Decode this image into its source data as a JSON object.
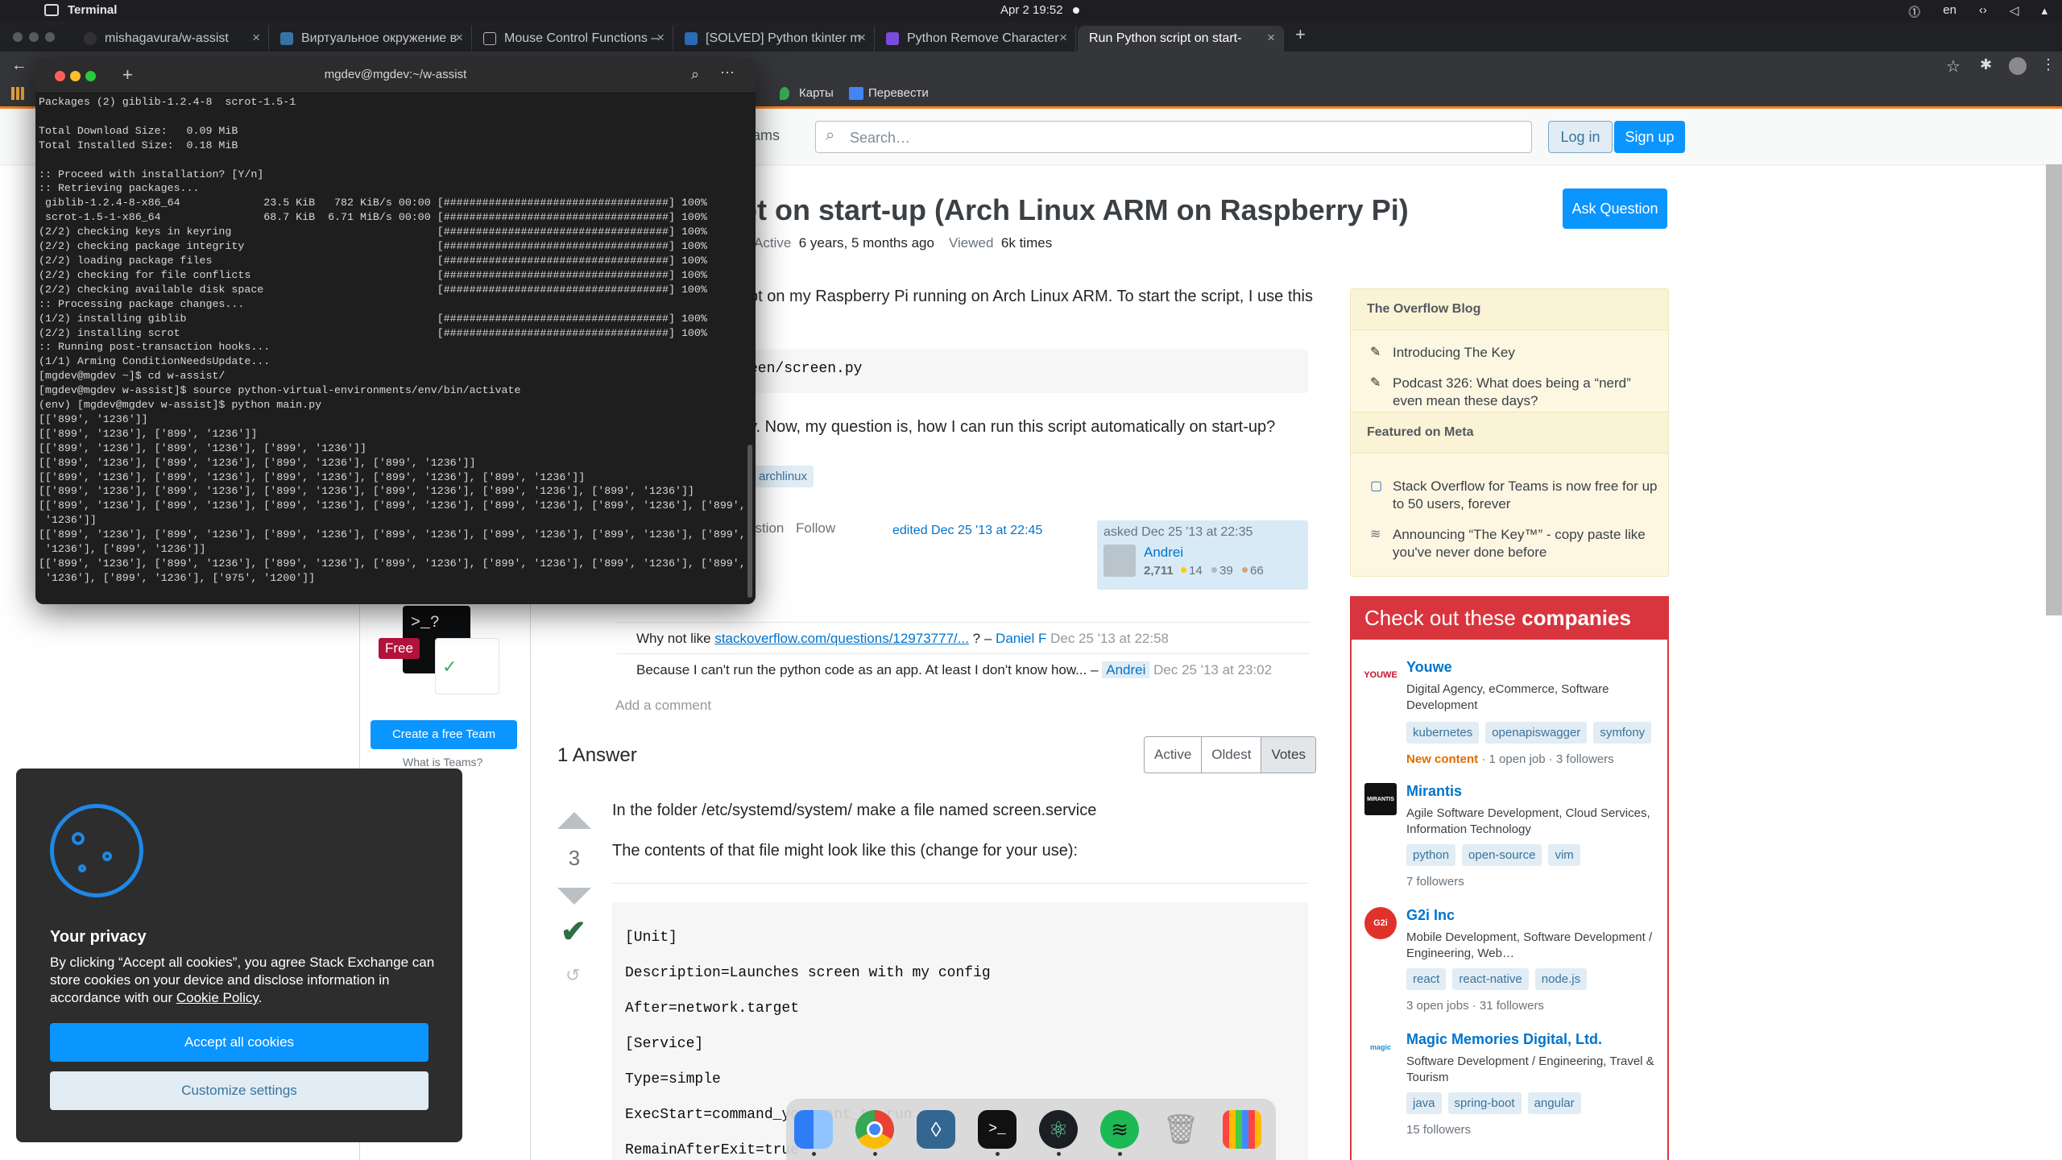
{
  "menubar": {
    "app_name": "Terminal",
    "clock": "Apr 2  19:52",
    "lang": "en"
  },
  "browser": {
    "tabs": [
      {
        "label": "mishagavura/w-assist"
      },
      {
        "label": "Виртуальное окружение в"
      },
      {
        "label": "Mouse Control Functions – "
      },
      {
        "label": "[SOLVED] Python tkinter m"
      },
      {
        "label": "Python Remove Character"
      },
      {
        "label": "Run Python script on start-"
      }
    ],
    "bookmarks": [
      {
        "label": "Карты"
      },
      {
        "label": "Перевести"
      }
    ]
  },
  "terminal": {
    "title": "mgdev@mgdev:~/w-assist",
    "lines": [
      "Packages (2) giblib-1.2.4-8  scrot-1.5-1",
      "",
      "Total Download Size:   0.09 MiB",
      "Total Installed Size:  0.18 MiB",
      "",
      ":: Proceed with installation? [Y/n]",
      ":: Retrieving packages...",
      " giblib-1.2.4-8-x86_64             23.5 KiB   782 KiB/s 00:00 [###################################] 100%",
      " scrot-1.5-1-x86_64                68.7 KiB  6.71 MiB/s 00:00 [###################################] 100%",
      "(2/2) checking keys in keyring                                [###################################] 100%",
      "(2/2) checking package integrity                              [###################################] 100%",
      "(2/2) loading package files                                   [###################################] 100%",
      "(2/2) checking for file conflicts                             [###################################] 100%",
      "(2/2) checking available disk space                           [###################################] 100%",
      ":: Processing package changes...",
      "(1/2) installing giblib                                       [###################################] 100%",
      "(2/2) installing scrot                                        [###################################] 100%",
      ":: Running post-transaction hooks...",
      "(1/1) Arming ConditionNeedsUpdate...",
      "[mgdev@mgdev ~]$ cd w-assist/",
      "[mgdev@mgdev w-assist]$ source python-virtual-environments/env/bin/activate",
      "(env) [mgdev@mgdev w-assist]$ python main.py",
      "[['899', '1236']]",
      "[['899', '1236'], ['899', '1236']]",
      "[['899', '1236'], ['899', '1236'], ['899', '1236']]",
      "[['899', '1236'], ['899', '1236'], ['899', '1236'], ['899', '1236']]",
      "[['899', '1236'], ['899', '1236'], ['899', '1236'], ['899', '1236'], ['899', '1236']]",
      "[['899', '1236'], ['899', '1236'], ['899', '1236'], ['899', '1236'], ['899', '1236'], ['899', '1236']]",
      "[['899', '1236'], ['899', '1236'], ['899', '1236'], ['899', '1236'], ['899', '1236'], ['899', '1236'], ['899',",
      " '1236']]",
      "[['899', '1236'], ['899', '1236'], ['899', '1236'], ['899', '1236'], ['899', '1236'], ['899', '1236'], ['899',",
      " '1236'], ['899', '1236']]",
      "[['899', '1236'], ['899', '1236'], ['899', '1236'], ['899', '1236'], ['899', '1236'], ['899', '1236'], ['899',",
      " '1236'], ['899', '1236'], ['975', '1200']]"
    ]
  },
  "so": {
    "nav_teams": "ams",
    "search_placeholder": "Search…",
    "login": "Log in",
    "signup": "Sign up",
    "title": "pt on start-up (Arch Linux ARM on Raspberry Pi)",
    "ask_question": "Ask Question",
    "active_label": "Active",
    "active_value": "6 years, 5 months ago",
    "viewed_label": "Viewed",
    "viewed_value": "6k times",
    "question_line1": "pt on my Raspberry Pi running on Arch Linux ARM. To start the script, I use this",
    "question_code": "een/screen.py",
    "question_line2": "y. Now, my question is, how I can run this script automatically on start-up?",
    "tag": "archlinux",
    "actions_share": "estion",
    "actions_follow": "Follow",
    "edited": "edited Dec 25 '13 at 22:45",
    "asked": "asked Dec 25 '13 at 22:35",
    "asker": "Andrei",
    "rep": "2,711",
    "gold": "14",
    "silver": "39",
    "bronze": "66",
    "comments": [
      {
        "text": "Why not like ",
        "link": "stackoverflow.com/questions/12973777/...",
        "mid": " ? – ",
        "user": "Daniel F",
        "date": "Dec 25 '13 at 22:58"
      },
      {
        "text": "Because I can't run the python code as an app. At least I don't know how... – ",
        "link": "",
        "mid": "",
        "user": "Andrei",
        "date": "Dec 25 '13 at 23:02"
      }
    ],
    "add_comment": "Add a comment",
    "answers_count": "1 Answer",
    "sort_tabs": [
      "Active",
      "Oldest",
      "Votes"
    ],
    "vote_count": "3",
    "answer_line1": "In the folder /etc/systemd/system/ make a file named screen.service",
    "answer_line2": "The contents of that file might look like this (change for your use):",
    "code_lines": [
      "[Unit]",
      "Description=Launches screen with my config",
      "After=network.target",
      "[Service]",
      "Type=simple",
      "ExecStart=command_you_want_to_run",
      "RemainAfterExit=true"
    ],
    "teams_free_badge": "Free",
    "create_team": "Create a free Team",
    "what_is_teams": "What is Teams?",
    "blog": {
      "header": "The Overflow Blog",
      "items": [
        "Introducing The Key",
        "Podcast 326: What does being a “nerd” even mean these days?"
      ],
      "meta_header": "Featured on Meta",
      "meta_items": [
        "Stack Overflow for Teams is now free for up to 50 users, forever",
        "Announcing “The Key™” - copy paste like you've never done before"
      ]
    },
    "companies": {
      "header_pre": "Check out these ",
      "header_bold": "companies",
      "list": [
        {
          "name": "Youwe",
          "logo": "YOUWE",
          "desc": "Digital Agency, eCommerce, Software Development",
          "tags": [
            "kubernetes",
            "openapiswagger",
            "symfony"
          ],
          "new": "New content",
          "footer": " · 1 open job · 3 followers"
        },
        {
          "name": "Mirantis",
          "logo": "MIRANTIS",
          "desc": "Agile Software Development, Cloud Services, Information Technology",
          "tags": [
            "python",
            "open-source",
            "vim"
          ],
          "new": "",
          "footer": "7 followers"
        },
        {
          "name": "G2i Inc",
          "logo": "G2i",
          "desc": "Mobile Development, Software Development / Engineering, Web…",
          "tags": [
            "react",
            "react-native",
            "node.js"
          ],
          "new": "",
          "footer": "3 open jobs · 31 followers"
        },
        {
          "name": "Magic Memories Digital, Ltd.",
          "logo": "magic",
          "desc": "Software Development / Engineering, Travel & Tourism",
          "tags": [
            "java",
            "spring-boot",
            "angular"
          ],
          "new": "",
          "footer": "15 followers"
        }
      ]
    },
    "cookie": {
      "title": "Your privacy",
      "body": "By clicking “Accept all cookies”, you agree Stack Exchange can store cookies on your device and disclose information in accordance with our ",
      "policy": "Cookie Policy",
      "accept": "Accept all cookies",
      "customize": "Customize settings"
    }
  }
}
